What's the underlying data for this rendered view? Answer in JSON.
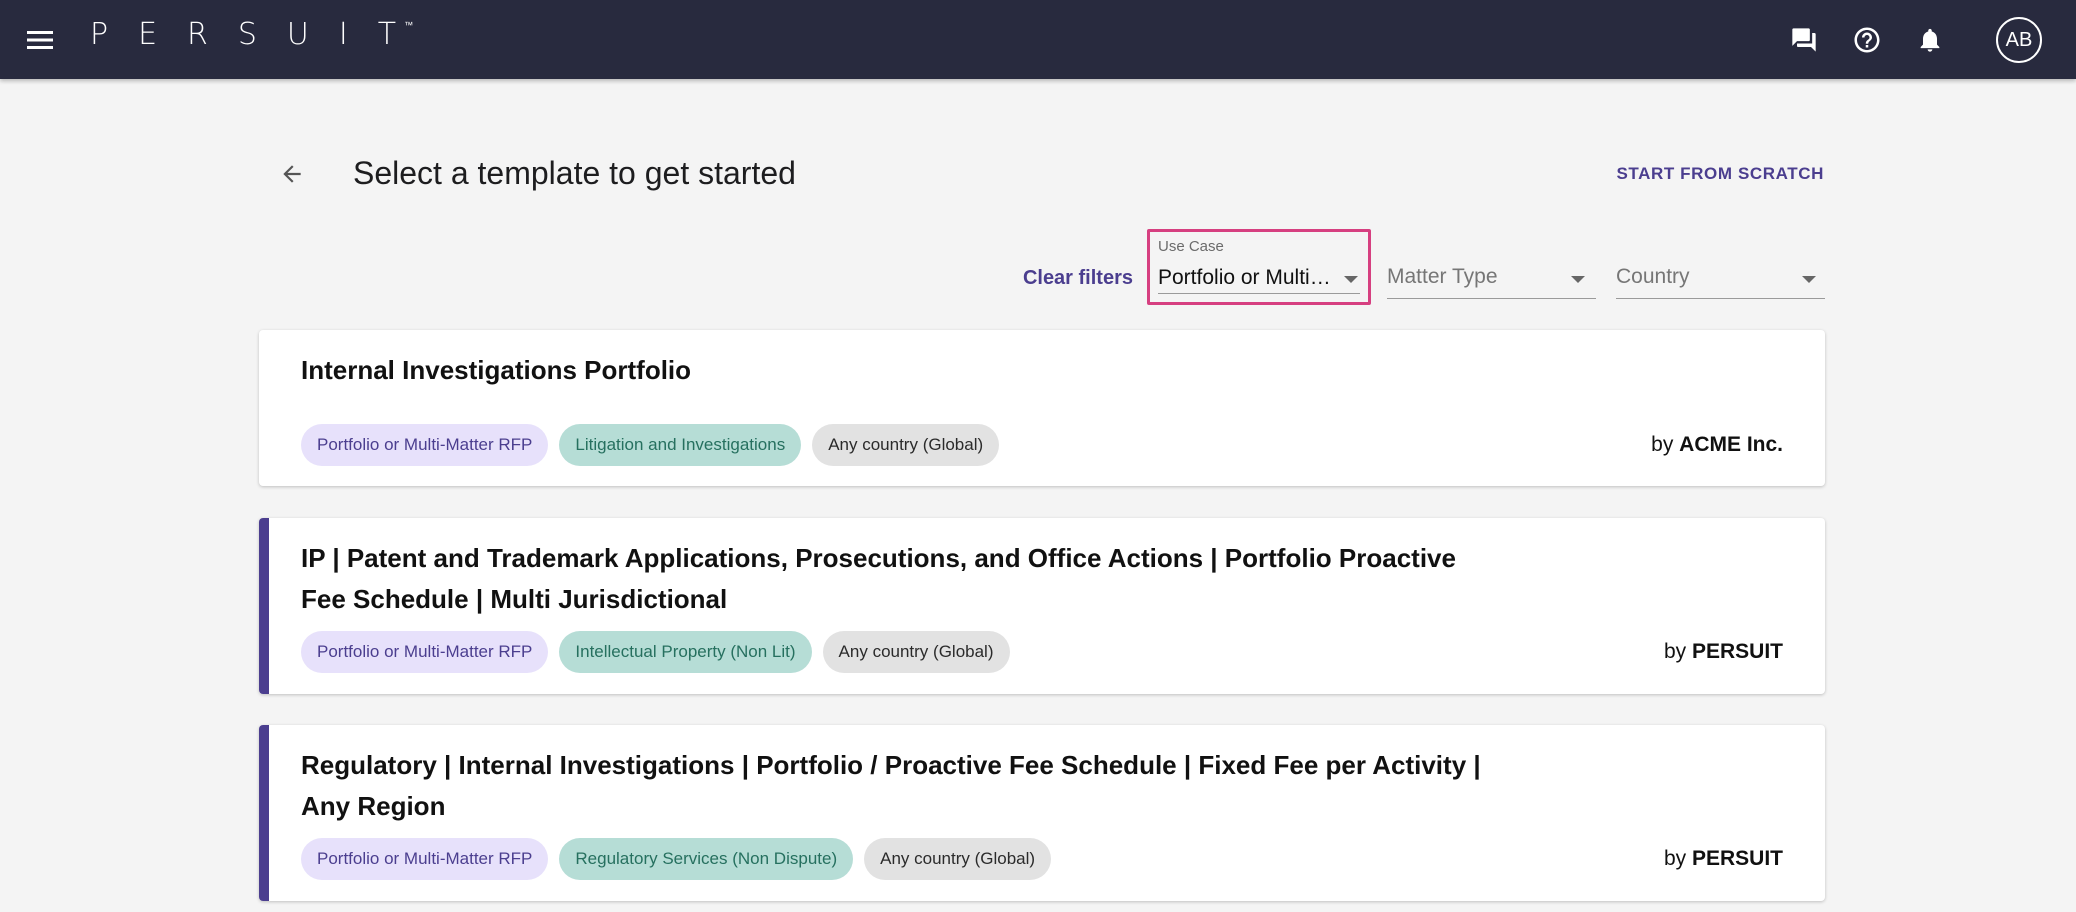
{
  "app": {
    "logo": "PERSUIT",
    "logo_tm": "™",
    "user_initials": "AB"
  },
  "page": {
    "title": "Select a template to get started",
    "start_from_scratch": "START FROM SCRATCH"
  },
  "filters": {
    "clear_label": "Clear filters",
    "use_case": {
      "label": "Use Case",
      "value": "Portfolio or Multi…"
    },
    "matter_type": {
      "placeholder": "Matter Type"
    },
    "country": {
      "placeholder": "Country"
    }
  },
  "templates": [
    {
      "title": "Internal Investigations Portfolio",
      "tags": [
        "Portfolio or Multi-Matter RFP",
        "Litigation and Investigations",
        "Any country (Global)"
      ],
      "by_prefix": "by",
      "author": "ACME Inc."
    },
    {
      "title": "IP | Patent and Trademark Applications, Prosecutions, and Office Actions | Portfolio Proactive Fee Schedule | Multi Jurisdictional",
      "tags": [
        "Portfolio or Multi-Matter RFP",
        "Intellectual Property (Non Lit)",
        "Any country (Global)"
      ],
      "by_prefix": "by",
      "author": "PERSUIT"
    },
    {
      "title": "Regulatory | Internal Investigations | Portfolio / Proactive Fee Schedule | Fixed Fee per Activity | Any Region",
      "tags": [
        "Portfolio or Multi-Matter RFP",
        "Regulatory Services (Non Dispute)",
        "Any country (Global)"
      ],
      "by_prefix": "by",
      "author": "PERSUIT"
    }
  ],
  "colors": {
    "appbar": "#282a3e",
    "accent": "#4b3e8f",
    "focus_border": "#d63f80"
  }
}
